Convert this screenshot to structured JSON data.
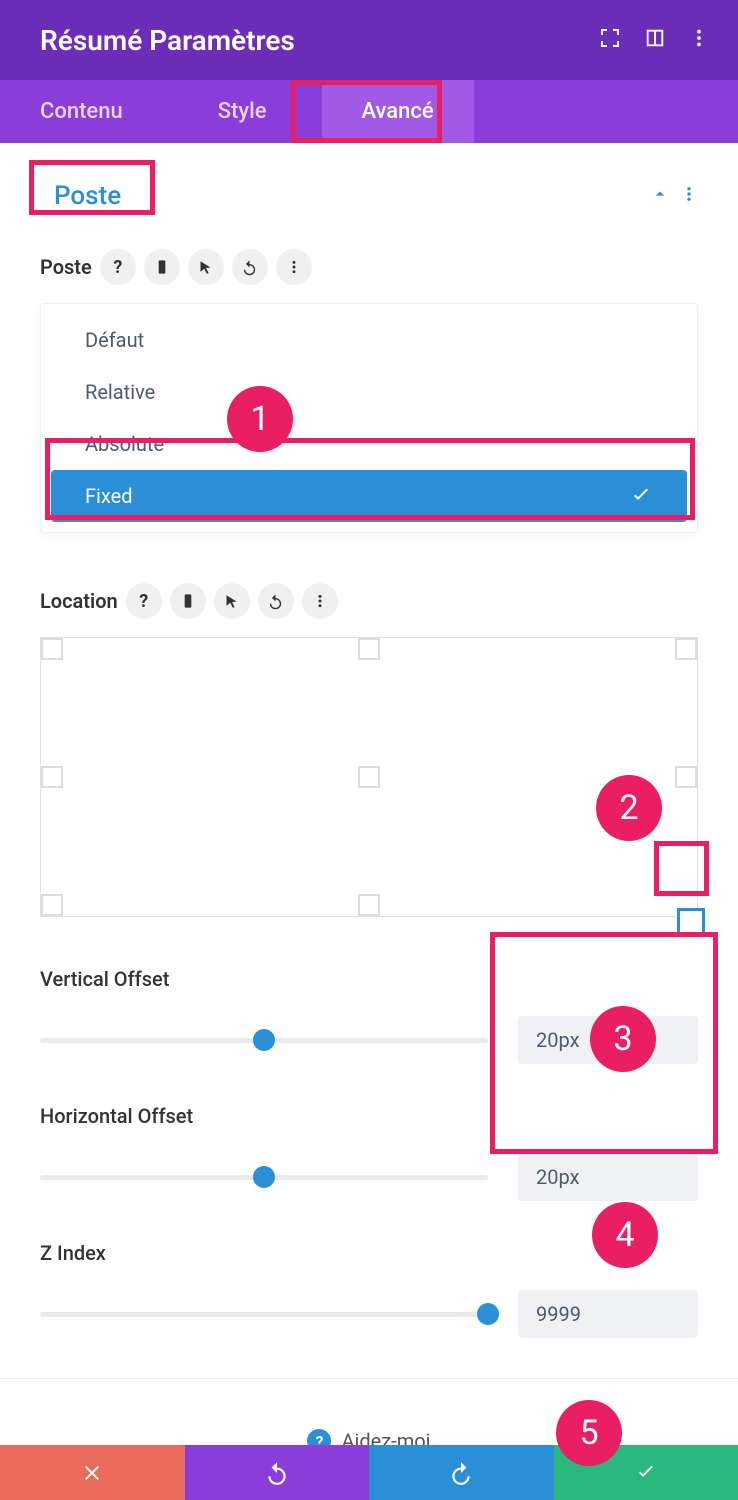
{
  "header": {
    "title": "Résumé Paramètres"
  },
  "tabs": {
    "contenu": "Contenu",
    "style": "Style",
    "avance": "Avancé"
  },
  "section": {
    "title": "Poste"
  },
  "poste": {
    "label": "Poste",
    "options": {
      "defaut": "Défaut",
      "relative": "Relative",
      "absolute": "Absolute",
      "fixed": "Fixed"
    }
  },
  "location": {
    "label": "Location"
  },
  "vertical": {
    "label": "Vertical Offset",
    "value": "20px"
  },
  "horizontal": {
    "label": "Horizontal Offset",
    "value": "20px"
  },
  "zindex": {
    "label": "Z Index",
    "value": "9999"
  },
  "help": {
    "text": "Aidez-moi"
  },
  "annotations": {
    "a1": "1",
    "a2": "2",
    "a3": "3",
    "a4": "4",
    "a5": "5"
  }
}
